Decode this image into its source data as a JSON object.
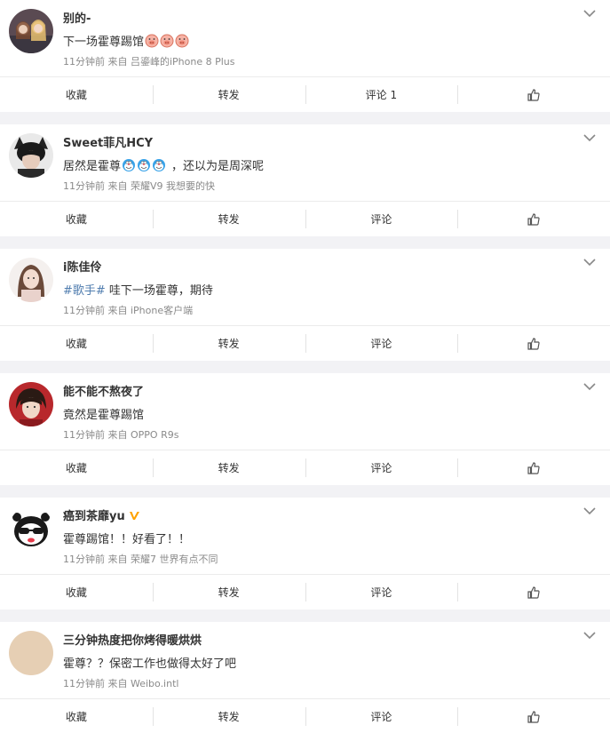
{
  "actions": {
    "favorite": "收藏",
    "repost": "转发",
    "comment": "评论"
  },
  "posts": [
    {
      "name": "别的-",
      "text": "下一场霍尊踢馆",
      "meta": "11分钟前 来自 吕鎏峰的iPhone 8 Plus",
      "comment_count": "评论 1",
      "emoji_icon": "pig-face-icon"
    },
    {
      "name": "Sweet菲凡HCY",
      "text_before": "居然是霍尊",
      "text_after": "，还以为是周深呢",
      "meta": "11分钟前 来自 荣耀V9 我想要的快",
      "comment_count": "评论",
      "emoji_icon": "doraemon-icon"
    },
    {
      "name": "i陈佳伶",
      "topic": "#歌手#",
      "text": " 哇下一场霍尊，期待",
      "meta": "11分钟前 来自 iPhone客户端",
      "comment_count": "评论"
    },
    {
      "name": "能不能不熬夜了",
      "text": "竟然是霍尊踢馆",
      "meta": "11分钟前 来自 OPPO R9s",
      "comment_count": "评论"
    },
    {
      "name": "癌到茶靡yu",
      "text": "霍尊踢馆！！好看了！！",
      "meta": "11分钟前 来自 荣耀7 世界有点不同",
      "comment_count": "评论",
      "badge_icon": "verified-v-icon"
    },
    {
      "name": "三分钟热度把你烤得暖烘烘",
      "text": "霍尊？？保密工作也做得太好了吧",
      "meta": "11分钟前 来自 Weibo.intl",
      "comment_count": "评论"
    }
  ],
  "colors": {
    "topic": "#507daf",
    "meta": "#8a8a8a",
    "background": "#f2f2f5",
    "badge": "#ffa200"
  }
}
